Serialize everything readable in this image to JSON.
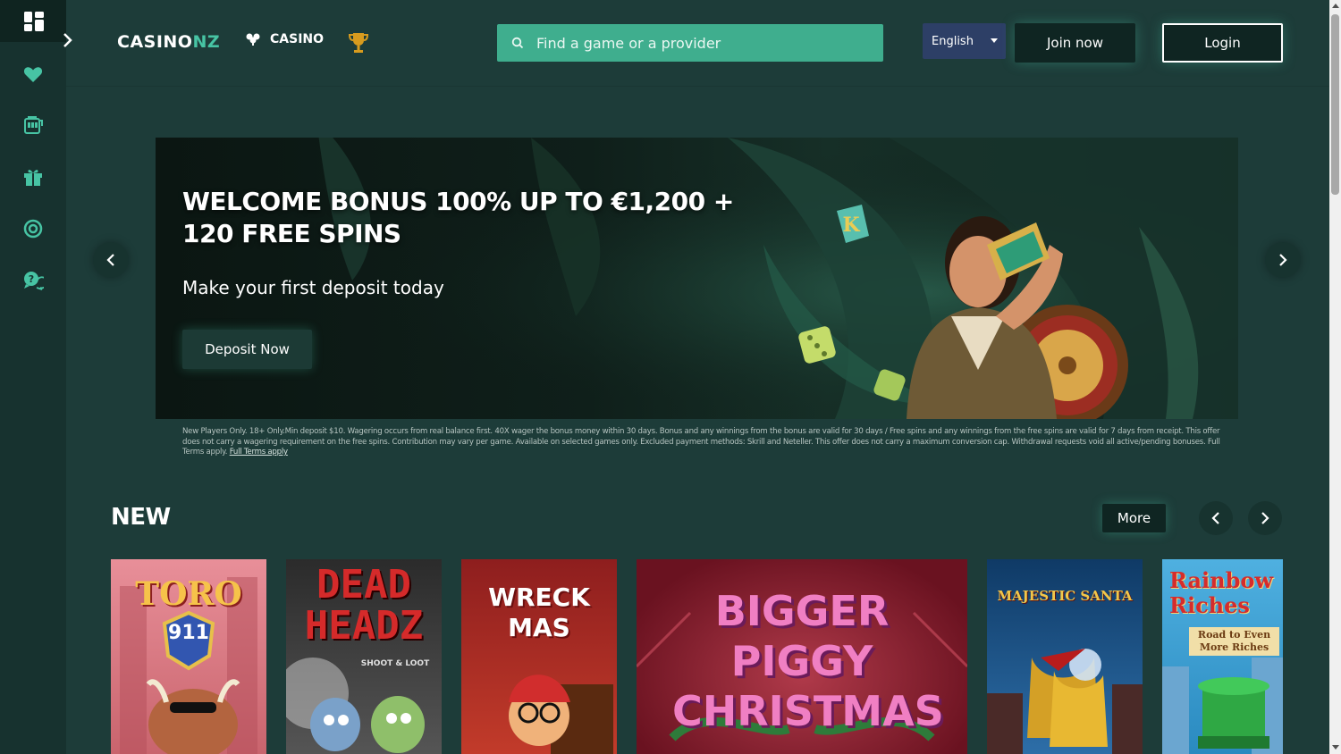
{
  "header": {
    "logo_prefix": "CASINO",
    "logo_suffix": "NZ",
    "casino_label": "CASINO",
    "search_placeholder": "Find a game or a provider",
    "language": "English",
    "join_label": "Join now",
    "login_label": "Login"
  },
  "sidebar": {
    "items": [
      {
        "icon": "dashboard-icon"
      },
      {
        "icon": "heart-icon"
      },
      {
        "icon": "slot-machine-icon"
      },
      {
        "icon": "gift-icon"
      },
      {
        "icon": "lifebuoy-icon"
      },
      {
        "icon": "chat-help-icon"
      }
    ]
  },
  "banner": {
    "title_line1": "WELCOME BONUS 100% UP TO €1,200 +",
    "title_line2": "120 FREE SPINS",
    "subtitle": "Make your first deposit today",
    "cta_label": "Deposit Now",
    "terms_text": "New Players Only. 18+ Only.Min deposit $10. Wagering occurs from real balance first. 40X wager the bonus money within 30 days. Bonus and any winnings from the bonus are valid for 30 days / Free spins and any winnings from the free spins are valid for 7 days from receipt. This offer does not carry a wagering requirement on the free spins. Contribution may vary per game. Available on selected games only. Excluded payment methods: Skrill and Neteller. This offer does not carry a maximum conversion cap. Withdrawal requests void all active/pending bonuses. Full Terms apply.",
    "terms_link": "Full Terms apply"
  },
  "new_section": {
    "title": "NEW",
    "more_label": "More",
    "games": [
      {
        "title": "TORO",
        "subtitle": "911"
      },
      {
        "title": "DEAD HEADZ",
        "subtitle": "SHOOT & LOOT"
      },
      {
        "title": "WRECK MAS",
        "subtitle": ""
      },
      {
        "title": "BIGGER PIGGY CHRISTMAS",
        "subtitle": ""
      },
      {
        "title": "MAJESTIC SANTA",
        "subtitle": ""
      },
      {
        "title": "Rainbow Riches",
        "subtitle": "Road to Even More Riches"
      }
    ]
  },
  "colors": {
    "background": "#1d3c39",
    "sidebar": "#17322f",
    "accent": "#47c4a4",
    "search": "#3fae8e",
    "lang": "#2d3f66"
  }
}
